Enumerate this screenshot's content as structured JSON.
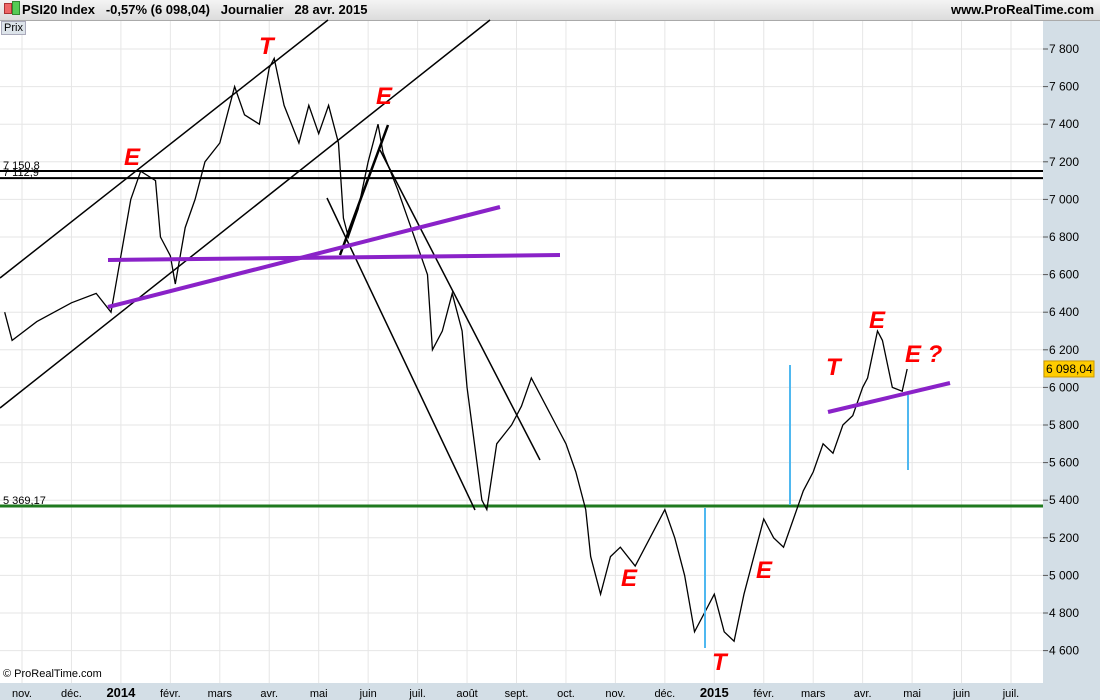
{
  "header": {
    "title": "PSI20 Index",
    "change": "-0,57% (6 098,04)",
    "period": "Journalier",
    "date": "28 avr. 2015",
    "site": "www.ProRealTime.com"
  },
  "prix_label": "Prix",
  "copyright": "© ProRealTime.com",
  "levels": [
    {
      "label": "7 150,8",
      "value": 7150.8
    },
    {
      "label": "7 112,9",
      "value": 7112.9
    },
    {
      "label": "5 369,17",
      "value": 5369.17
    }
  ],
  "annotations": [
    "T",
    "E",
    "E",
    "E",
    "T",
    "E",
    "E",
    "T",
    "E ?"
  ],
  "chart_data": {
    "type": "line",
    "title": "PSI20 Index",
    "current_label": "6 098,04",
    "current": 6098.04,
    "ylim": [
      4500,
      7950
    ],
    "yticks": [
      {
        "v": 4600,
        "l": "4 600"
      },
      {
        "v": 4800,
        "l": "4 800"
      },
      {
        "v": 5000,
        "l": "5 000"
      },
      {
        "v": 5200,
        "l": "5 200"
      },
      {
        "v": 5400,
        "l": "5 400"
      },
      {
        "v": 5600,
        "l": "5 600"
      },
      {
        "v": 5800,
        "l": "5 800"
      },
      {
        "v": 6000,
        "l": "6 000"
      },
      {
        "v": 6200,
        "l": "6 200"
      },
      {
        "v": 6400,
        "l": "6 400"
      },
      {
        "v": 6600,
        "l": "6 600"
      },
      {
        "v": 6800,
        "l": "6 800"
      },
      {
        "v": 7000,
        "l": "7 000"
      },
      {
        "v": 7200,
        "l": "7 200"
      },
      {
        "v": 7400,
        "l": "7 400"
      },
      {
        "v": 7600,
        "l": "7 600"
      },
      {
        "v": 7800,
        "l": "7 800"
      }
    ],
    "xticks": [
      "nov.",
      "déc.",
      "2014",
      "févr.",
      "mars",
      "avr.",
      "mai",
      "juin",
      "juil.",
      "août",
      "sept.",
      "oct.",
      "nov.",
      "déc.",
      "2015",
      "févr.",
      "mars",
      "avr.",
      "mai",
      "juin",
      "juil."
    ],
    "series_month_index": [
      -0.35,
      -0.2,
      0.3,
      1,
      1.5,
      1.8,
      2,
      2.2,
      2.4,
      2.7,
      2.8,
      3,
      3.1,
      3.3,
      3.5,
      3.7,
      4,
      4.3,
      4.5,
      4.8,
      5,
      5.1,
      5.3,
      5.6,
      5.8,
      6,
      6.2,
      6.4,
      6.5,
      6.6,
      6.8,
      7,
      7.2,
      7.3,
      7.6,
      7.8,
      8,
      8.2,
      8.3,
      8.5,
      8.7,
      8.9,
      9,
      9.1,
      9.3,
      9.4,
      9.6,
      9.9,
      10.1,
      10.3,
      10.6,
      10.8,
      11,
      11.2,
      11.4,
      11.5,
      11.7,
      11.9,
      12.1,
      12.4,
      12.7,
      13,
      13.2,
      13.4,
      13.6,
      13.8,
      14,
      14.2,
      14.4,
      14.6,
      14.8,
      15,
      15.2,
      15.4,
      15.6,
      15.8,
      16,
      16.2,
      16.4,
      16.6,
      16.8,
      17,
      17.1,
      17.3,
      17.4,
      17.6,
      17.8,
      17.9
    ],
    "series_close": [
      6400,
      6250,
      6350,
      6450,
      6500,
      6400,
      6700,
      7000,
      7150,
      7100,
      6800,
      6700,
      6550,
      6850,
      7000,
      7200,
      7300,
      7600,
      7450,
      7400,
      7700,
      7750,
      7500,
      7300,
      7500,
      7350,
      7500,
      7300,
      6900,
      6800,
      6950,
      7200,
      7400,
      7250,
      7050,
      6900,
      6750,
      6600,
      6200,
      6300,
      6500,
      6300,
      6000,
      5800,
      5400,
      5350,
      5700,
      5800,
      5900,
      6050,
      5900,
      5800,
      5700,
      5550,
      5350,
      5100,
      4900,
      5100,
      5150,
      5050,
      5200,
      5350,
      5200,
      5000,
      4700,
      4800,
      4900,
      4700,
      4650,
      4900,
      5100,
      5300,
      5200,
      5150,
      5300,
      5450,
      5550,
      5700,
      5650,
      5800,
      5850,
      6000,
      6050,
      6300,
      6250,
      6000,
      5980,
      6098
    ]
  }
}
